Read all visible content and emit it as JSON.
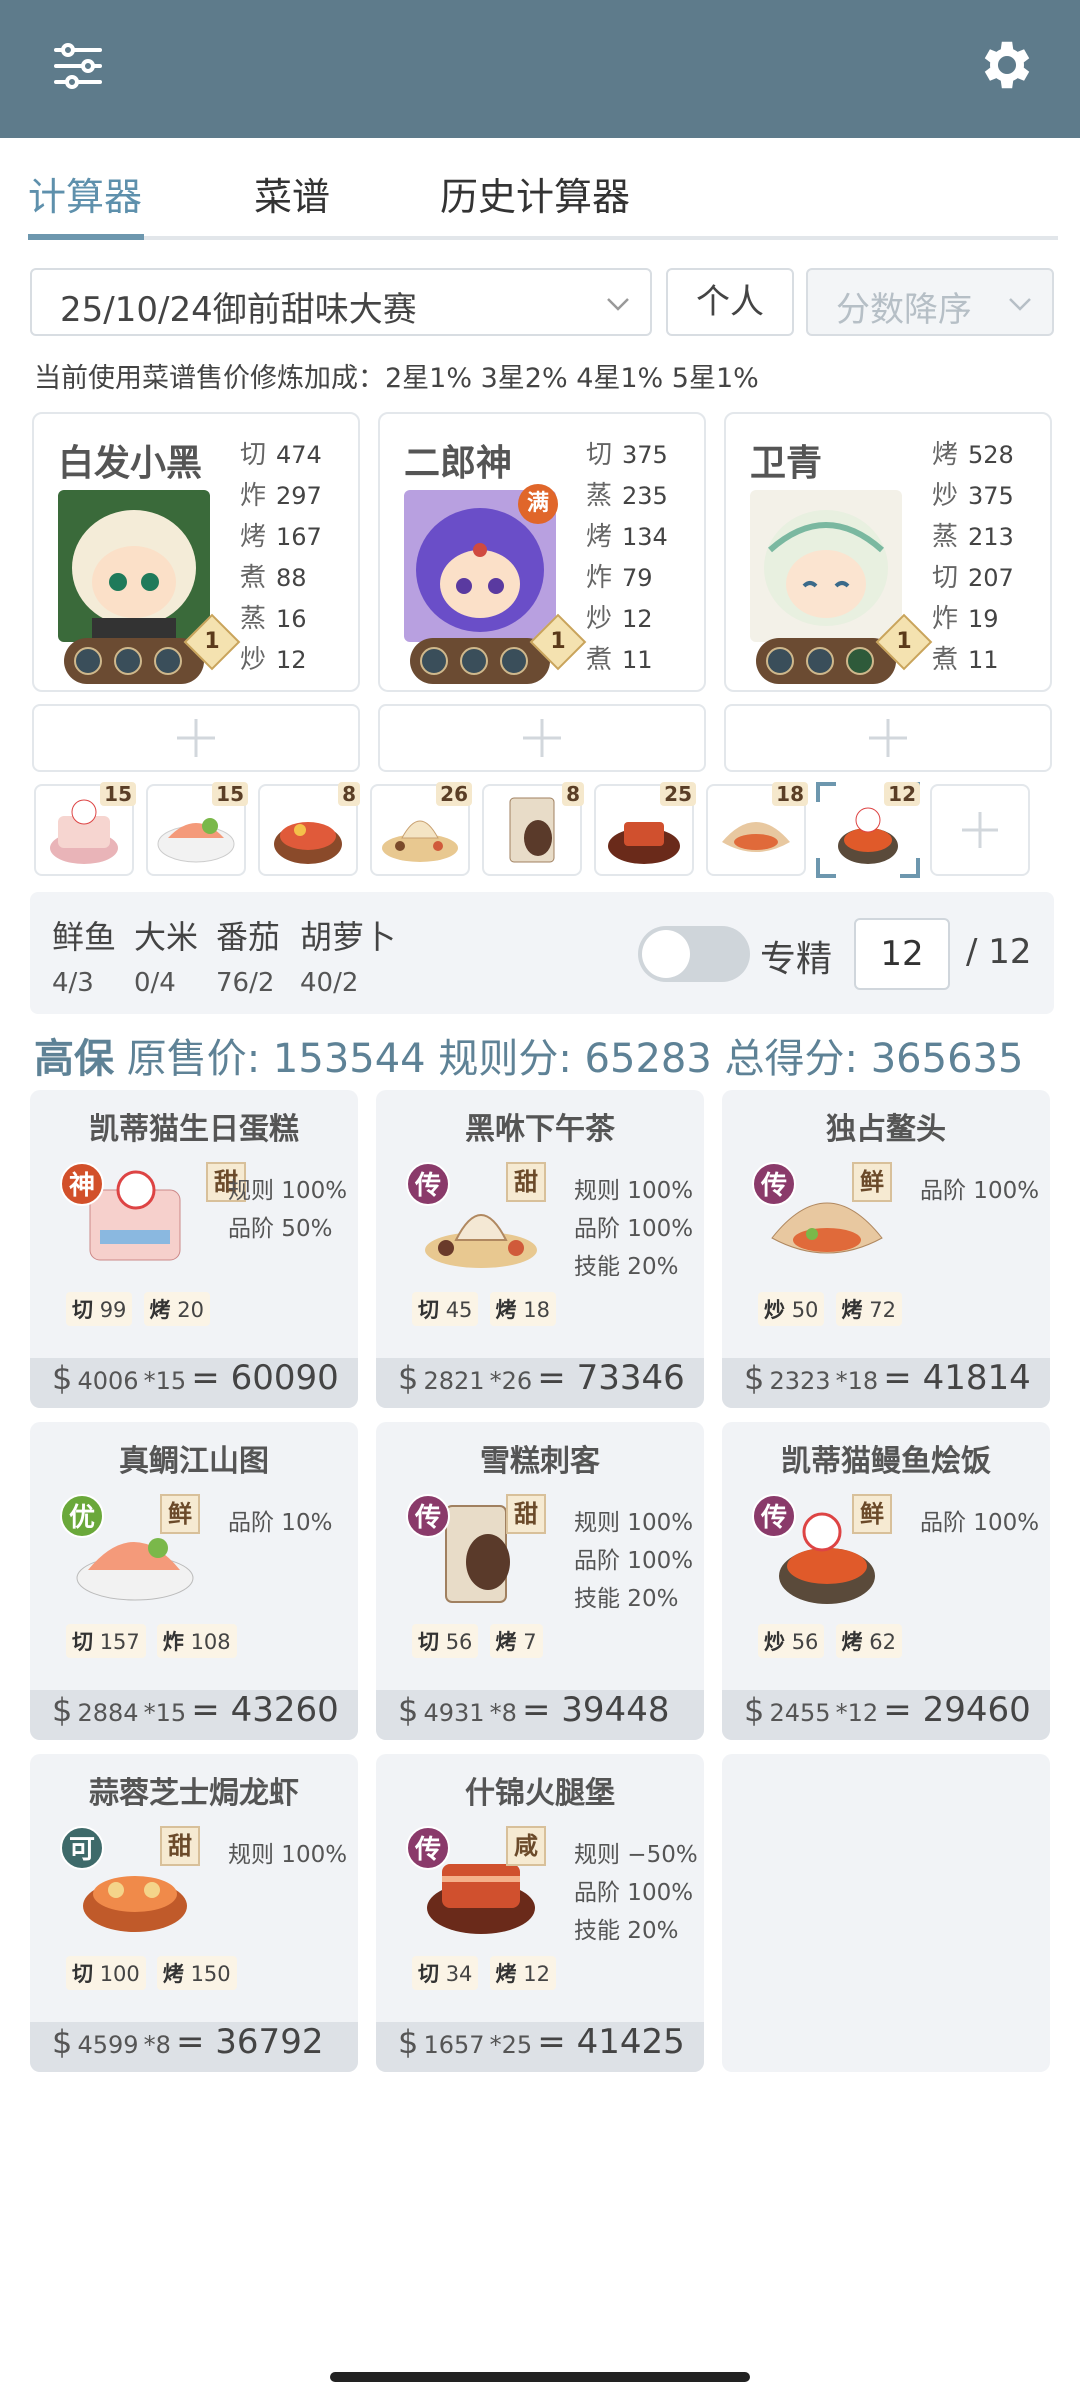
{
  "tabs": [
    "计算器",
    "菜谱",
    "历史计算器"
  ],
  "filters": {
    "contest": "25/10/24御前甜味大赛",
    "mode": "个人",
    "sort": "分数降序"
  },
  "note": "当前使用菜谱售价修炼加成：2星1% 3星2% 4星1% 5星1%",
  "chefs": [
    {
      "name": "白发小黑",
      "level": "1",
      "badge": "",
      "stats": [
        [
          "切",
          "474"
        ],
        [
          "炸",
          "297"
        ],
        [
          "烤",
          "167"
        ],
        [
          "煮",
          "88"
        ],
        [
          "蒸",
          "16"
        ],
        [
          "炒",
          "12"
        ]
      ]
    },
    {
      "name": "二郎神",
      "level": "1",
      "badge": "满",
      "stats": [
        [
          "切",
          "375"
        ],
        [
          "蒸",
          "235"
        ],
        [
          "烤",
          "134"
        ],
        [
          "炸",
          "79"
        ],
        [
          "炒",
          "12"
        ],
        [
          "煮",
          "11"
        ]
      ]
    },
    {
      "name": "卫青",
      "level": "1",
      "badge": "",
      "stats": [
        [
          "烤",
          "528"
        ],
        [
          "炒",
          "375"
        ],
        [
          "蒸",
          "213"
        ],
        [
          "切",
          "207"
        ],
        [
          "炸",
          "19"
        ],
        [
          "煮",
          "11"
        ]
      ]
    }
  ],
  "strip_counts": [
    "15",
    "15",
    "8",
    "26",
    "8",
    "25",
    "18",
    "12"
  ],
  "ingredients": [
    {
      "name": "鲜鱼",
      "qty": "4/3"
    },
    {
      "name": "大米",
      "qty": "0/4"
    },
    {
      "name": "番茄",
      "qty": "76/2"
    },
    {
      "name": "胡萝卜",
      "qty": "40/2"
    }
  ],
  "expert": {
    "label": "专精",
    "value": "12",
    "total": "/ 12"
  },
  "summary": {
    "tier": "高保",
    "orig_label": "原售价:",
    "orig": "153544",
    "rule_label": "规则分:",
    "rule": "65283",
    "total_label": "总得分:",
    "total": "365635"
  },
  "dishes": [
    {
      "name": "凯蒂猫生日蛋糕",
      "rarity": "神",
      "rarity_color": "#d2502a",
      "flavor": "甜",
      "info": [
        "规则 100%",
        "品阶 50%"
      ],
      "skills": [
        [
          "切",
          "99"
        ],
        [
          "烤",
          "20"
        ]
      ],
      "price": "4006",
      "mult": "*15",
      "total": "60090"
    },
    {
      "name": "黑咻下午茶",
      "rarity": "传",
      "rarity_color": "#8a3a6a",
      "flavor": "甜",
      "info": [
        "规则 100%",
        "品阶 100%",
        "技能 20%"
      ],
      "skills": [
        [
          "切",
          "45"
        ],
        [
          "烤",
          "18"
        ]
      ],
      "price": "2821",
      "mult": "*26",
      "total": "73346"
    },
    {
      "name": "独占鳌头",
      "rarity": "传",
      "rarity_color": "#8a3a6a",
      "flavor": "鲜",
      "info": [
        "品阶 100%"
      ],
      "skills": [
        [
          "炒",
          "50"
        ],
        [
          "烤",
          "72"
        ]
      ],
      "price": "2323",
      "mult": "*18",
      "total": "41814"
    },
    {
      "name": "真鲷江山图",
      "rarity": "优",
      "rarity_color": "#6aa83a",
      "flavor": "鲜",
      "info": [
        "品阶 10%"
      ],
      "skills": [
        [
          "切",
          "157"
        ],
        [
          "炸",
          "108"
        ]
      ],
      "price": "2884",
      "mult": "*15",
      "total": "43260"
    },
    {
      "name": "雪糕刺客",
      "rarity": "传",
      "rarity_color": "#8a3a6a",
      "flavor": "甜",
      "info": [
        "规则 100%",
        "品阶 100%",
        "技能 20%"
      ],
      "skills": [
        [
          "切",
          "56"
        ],
        [
          "烤",
          "7"
        ]
      ],
      "price": "4931",
      "mult": "*8",
      "total": "39448"
    },
    {
      "name": "凯蒂猫鳗鱼烩饭",
      "rarity": "传",
      "rarity_color": "#8a3a6a",
      "flavor": "鲜",
      "info": [
        "品阶 100%"
      ],
      "skills": [
        [
          "炒",
          "56"
        ],
        [
          "烤",
          "62"
        ]
      ],
      "price": "2455",
      "mult": "*12",
      "total": "29460"
    },
    {
      "name": "蒜蓉芝士焗龙虾",
      "rarity": "可",
      "rarity_color": "#3e6a6a",
      "flavor": "甜",
      "info": [
        "规则 100%"
      ],
      "skills": [
        [
          "切",
          "100"
        ],
        [
          "烤",
          "150"
        ]
      ],
      "price": "4599",
      "mult": "*8",
      "total": "36792"
    },
    {
      "name": "什锦火腿堡",
      "rarity": "传",
      "rarity_color": "#8a3a6a",
      "flavor": "咸",
      "info": [
        "规则 −50%",
        "品阶 100%",
        "技能 20%"
      ],
      "skills": [
        [
          "切",
          "34"
        ],
        [
          "烤",
          "12"
        ]
      ],
      "price": "1657",
      "mult": "*25",
      "total": "41425"
    }
  ]
}
